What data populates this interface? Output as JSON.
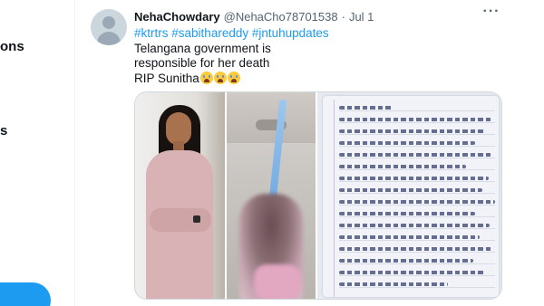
{
  "sidebar": {
    "notifications_partial": "ons",
    "lists_partial": "s"
  },
  "tweet": {
    "author": {
      "display_name": "NehaChowdary",
      "handle": "@NehaCho78701538",
      "separator": "·",
      "date": "Jul 1"
    },
    "hashtags": [
      "#ktrtrs",
      "#sabithareddy",
      "#jntuhupdates"
    ],
    "lines": [
      "Telangana government is",
      "responsible for her death",
      "RIP Sunitha"
    ],
    "emoji_count": 3,
    "media": [
      {
        "name": "photo-portrait"
      },
      {
        "name": "photo-blurred-scene"
      },
      {
        "name": "photo-handwritten-letter"
      }
    ]
  },
  "colors": {
    "accent": "#1d9bf0",
    "text_primary": "#0f1419",
    "text_secondary": "#536471",
    "border": "#cfd9de"
  }
}
